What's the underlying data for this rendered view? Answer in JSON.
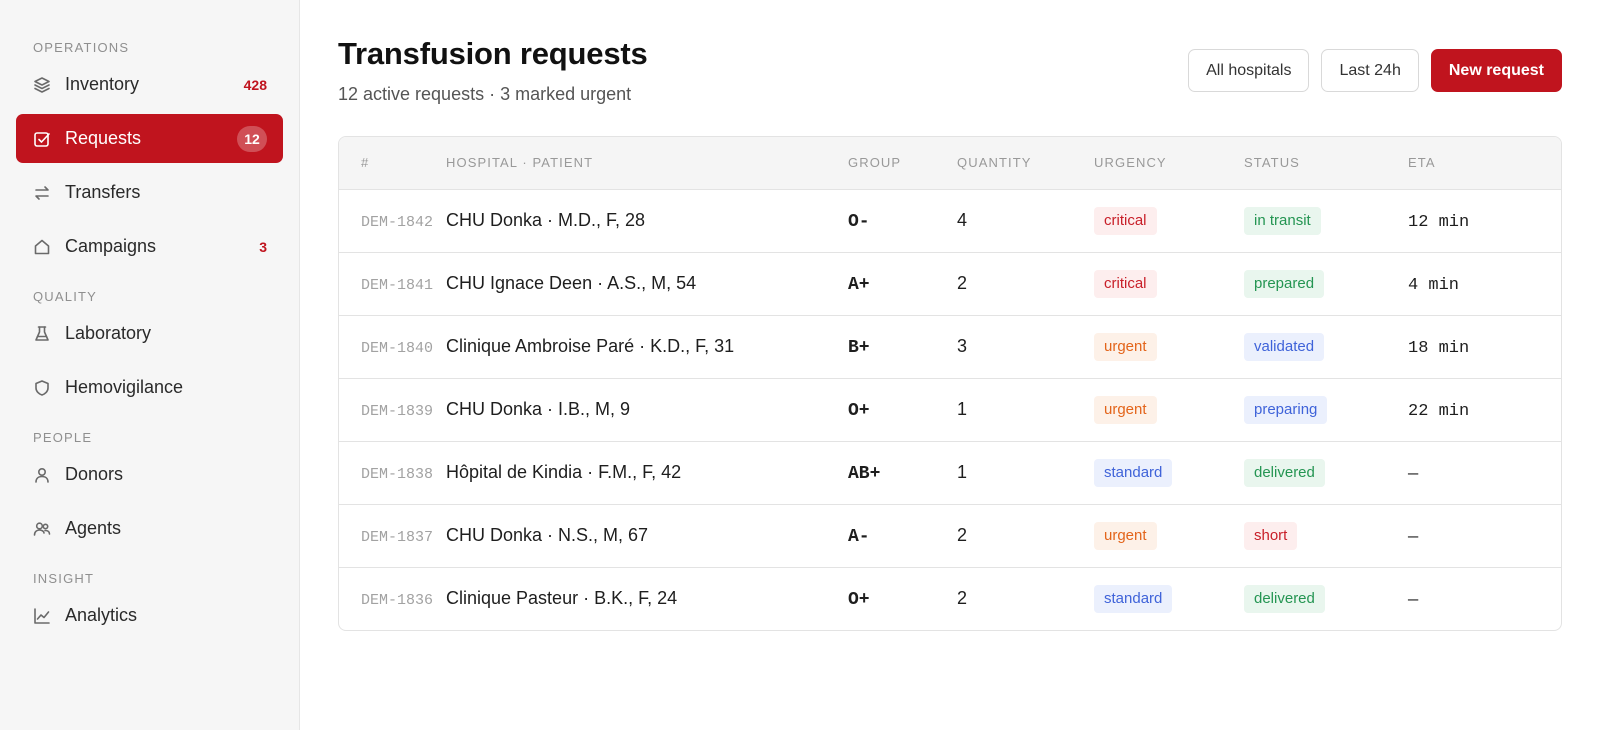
{
  "sidebar": {
    "sections": [
      {
        "title": "OPERATIONS",
        "items": [
          {
            "label": "Inventory",
            "icon": "layers-icon",
            "count": "428",
            "active": false
          },
          {
            "label": "Requests",
            "icon": "checkbox-icon",
            "count": "12",
            "active": true
          },
          {
            "label": "Transfers",
            "icon": "swap-arrows-icon",
            "count": "",
            "active": false
          },
          {
            "label": "Campaigns",
            "icon": "house-icon",
            "count": "3",
            "active": false
          }
        ]
      },
      {
        "title": "QUALITY",
        "items": [
          {
            "label": "Laboratory",
            "icon": "flask-icon",
            "count": "",
            "active": false
          },
          {
            "label": "Hemovigilance",
            "icon": "shield-icon",
            "count": "",
            "active": false
          }
        ]
      },
      {
        "title": "PEOPLE",
        "items": [
          {
            "label": "Donors",
            "icon": "user-icon",
            "count": "",
            "active": false
          },
          {
            "label": "Agents",
            "icon": "users-icon",
            "count": "",
            "active": false
          }
        ]
      },
      {
        "title": "INSIGHT",
        "items": [
          {
            "label": "Analytics",
            "icon": "line-chart-icon",
            "count": "",
            "active": false
          }
        ]
      }
    ]
  },
  "header": {
    "title": "Transfusion requests",
    "subtitle": "12 active requests · 3 marked urgent",
    "filter_hospitals": "All hospitals",
    "filter_time": "Last 24h",
    "new_request": "New request"
  },
  "table": {
    "columns": [
      "#",
      "HOSPITAL · PATIENT",
      "GROUP",
      "QUANTITY",
      "URGENCY",
      "STATUS",
      "ETA"
    ],
    "rows": [
      {
        "id": "DEM-1842",
        "hospital_patient": "CHU Donka · M.D., F, 28",
        "group": "O-",
        "quantity": "4",
        "urgency": "critical",
        "status": "in transit",
        "eta": "12 min"
      },
      {
        "id": "DEM-1841",
        "hospital_patient": "CHU Ignace Deen · A.S., M, 54",
        "group": "A+",
        "quantity": "2",
        "urgency": "critical",
        "status": "prepared",
        "eta": "4 min"
      },
      {
        "id": "DEM-1840",
        "hospital_patient": "Clinique Ambroise Paré · K.D., F, 31",
        "group": "B+",
        "quantity": "3",
        "urgency": "urgent",
        "status": "validated",
        "eta": "18 min"
      },
      {
        "id": "DEM-1839",
        "hospital_patient": "CHU Donka · I.B., M, 9",
        "group": "O+",
        "quantity": "1",
        "urgency": "urgent",
        "status": "preparing",
        "eta": "22 min"
      },
      {
        "id": "DEM-1838",
        "hospital_patient": "Hôpital de Kindia · F.M., F, 42",
        "group": "AB+",
        "quantity": "1",
        "urgency": "standard",
        "status": "delivered",
        "eta": "—"
      },
      {
        "id": "DEM-1837",
        "hospital_patient": "CHU Donka · N.S., M, 67",
        "group": "A-",
        "quantity": "2",
        "urgency": "urgent",
        "status": "short",
        "eta": "—"
      },
      {
        "id": "DEM-1836",
        "hospital_patient": "Clinique Pasteur · B.K., F, 24",
        "group": "O+",
        "quantity": "2",
        "urgency": "standard",
        "status": "delivered",
        "eta": "—"
      }
    ]
  },
  "colors": {
    "brand": "#c0141e",
    "critical": "#c81e28",
    "urgent": "#e3641a",
    "standard": "#3f63d9",
    "success": "#249552"
  }
}
